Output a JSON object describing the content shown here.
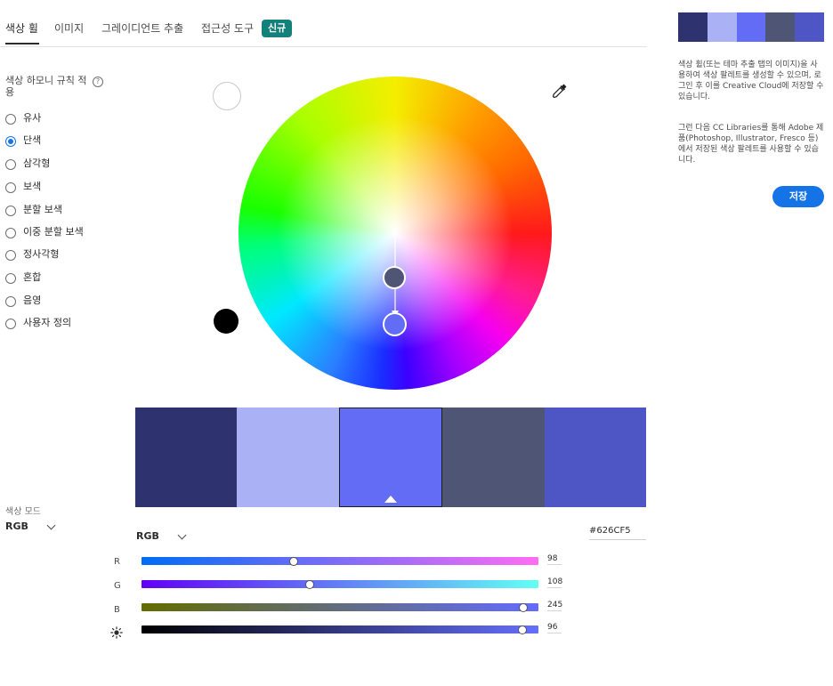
{
  "tabs": [
    {
      "label": "색상 휠",
      "active": true
    },
    {
      "label": "이미지",
      "active": false
    },
    {
      "label": "그레이디언트 추출",
      "active": false
    },
    {
      "label": "접근성 도구",
      "active": false
    }
  ],
  "new_badge": "신규",
  "harmony": {
    "title": "색상 하모니 규칙 적용",
    "help_icon": "?",
    "selected": "단색",
    "options": [
      "유사",
      "단색",
      "삼각형",
      "보색",
      "분할 보색",
      "이중 분할 보색",
      "정사각형",
      "혼합",
      "음영",
      "사용자 정의"
    ]
  },
  "color_mode": {
    "title": "색상 모드",
    "value": "RGB"
  },
  "palette": {
    "colors": [
      "#2E3370",
      "#AAB1F5",
      "#626CF5",
      "#4F5574",
      "#4E55C4"
    ],
    "active_index": 2
  },
  "editor": {
    "mode": "RGB",
    "hex": "#626CF5",
    "sliders": [
      {
        "label": "R",
        "value": "98",
        "fraction": 0.384,
        "gradient": [
          "#006cf5",
          "#ff6cf5"
        ]
      },
      {
        "label": "G",
        "value": "108",
        "fraction": 0.424,
        "gradient": [
          "#6200f5",
          "#62fff5"
        ]
      },
      {
        "label": "B",
        "value": "245",
        "fraction": 0.961,
        "gradient": [
          "#626c00",
          "#626cff"
        ]
      },
      {
        "label": "brightness",
        "value": "96",
        "fraction": 0.96,
        "gradient": [
          "#000000",
          "#656ffc"
        ]
      }
    ]
  },
  "side_panel": {
    "mini_palette": [
      "#2E3370",
      "#AAB1F5",
      "#626CF5",
      "#4F5574",
      "#4E55C4"
    ],
    "info_1": "색상 휠(또는 테마 추출 탭의 이미지)을 사용하여 색상 팔레트를 생성할 수 있으며, 로그인 후 이를 Creative Cloud에 저장할 수 있습니다.",
    "info_2": "그런 다음 CC Libraries를 통해 Adobe 제품(Photoshop, Illustrator, Fresco 등)에서 저장된 색상 팔레트를 사용할 수 있습니다.",
    "save_label": "저장"
  },
  "accent_color": "#1473E6",
  "badge_color": "#13807B"
}
